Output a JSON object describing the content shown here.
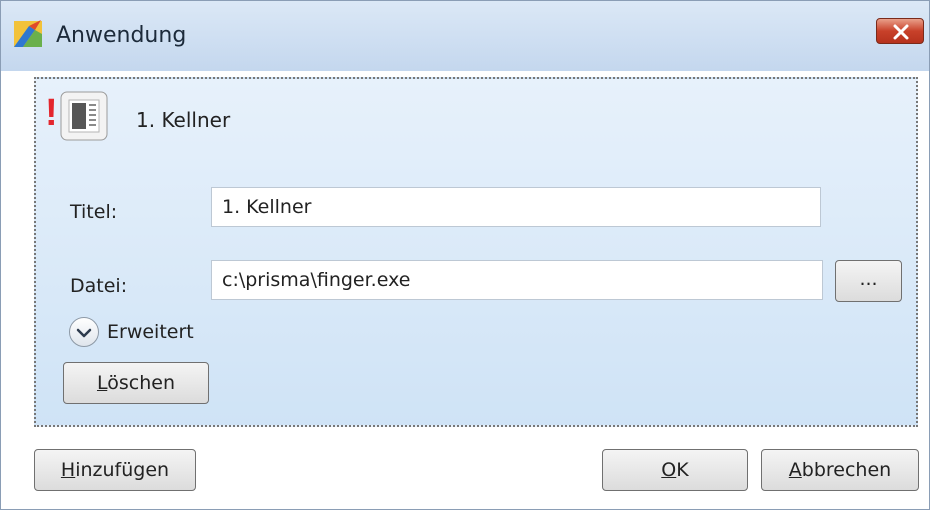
{
  "window": {
    "title": "Anwendung"
  },
  "item": {
    "title": "1. Kellner",
    "status_mark": "!"
  },
  "form": {
    "title_label": "Titel:",
    "title_value": "1. Kellner",
    "file_label": "Datei:",
    "file_value": "c:\\prisma\\finger.exe",
    "browse_label": "...",
    "advanced_label": "Erweitert",
    "delete_label_mnemonic": "L",
    "delete_label_rest": "öschen"
  },
  "footer": {
    "add_label_mnemonic": "H",
    "add_label_rest": "inzufügen",
    "ok_label_mnemonic": "O",
    "ok_label_rest": "K",
    "cancel_label_mnemonic": "A",
    "cancel_label_rest": "bbrechen"
  },
  "colors": {
    "title_bar": "#c4d7ee",
    "panel": "#dcebf9",
    "close_button": "#c8412a",
    "warning": "#e3262d"
  },
  "icons": {
    "app": "paint-app-icon",
    "close": "close-icon",
    "item": "document-icon",
    "expand": "chevron-down-icon"
  }
}
